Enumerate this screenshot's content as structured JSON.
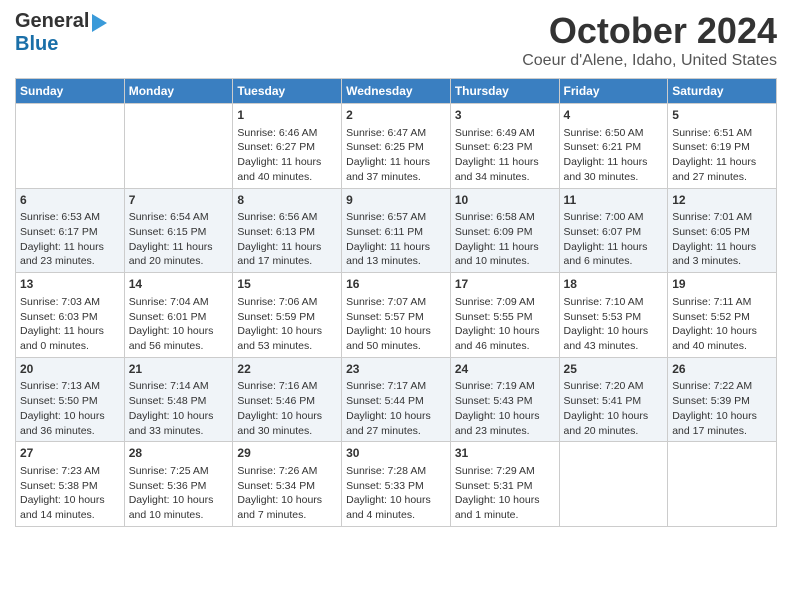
{
  "logo": {
    "line1": "General",
    "line2": "Blue"
  },
  "title": "October 2024",
  "subtitle": "Coeur d'Alene, Idaho, United States",
  "days_of_week": [
    "Sunday",
    "Monday",
    "Tuesday",
    "Wednesday",
    "Thursday",
    "Friday",
    "Saturday"
  ],
  "weeks": [
    [
      {
        "day": "",
        "content": ""
      },
      {
        "day": "",
        "content": ""
      },
      {
        "day": "1",
        "content": "Sunrise: 6:46 AM\nSunset: 6:27 PM\nDaylight: 11 hours\nand 40 minutes."
      },
      {
        "day": "2",
        "content": "Sunrise: 6:47 AM\nSunset: 6:25 PM\nDaylight: 11 hours\nand 37 minutes."
      },
      {
        "day": "3",
        "content": "Sunrise: 6:49 AM\nSunset: 6:23 PM\nDaylight: 11 hours\nand 34 minutes."
      },
      {
        "day": "4",
        "content": "Sunrise: 6:50 AM\nSunset: 6:21 PM\nDaylight: 11 hours\nand 30 minutes."
      },
      {
        "day": "5",
        "content": "Sunrise: 6:51 AM\nSunset: 6:19 PM\nDaylight: 11 hours\nand 27 minutes."
      }
    ],
    [
      {
        "day": "6",
        "content": "Sunrise: 6:53 AM\nSunset: 6:17 PM\nDaylight: 11 hours\nand 23 minutes."
      },
      {
        "day": "7",
        "content": "Sunrise: 6:54 AM\nSunset: 6:15 PM\nDaylight: 11 hours\nand 20 minutes."
      },
      {
        "day": "8",
        "content": "Sunrise: 6:56 AM\nSunset: 6:13 PM\nDaylight: 11 hours\nand 17 minutes."
      },
      {
        "day": "9",
        "content": "Sunrise: 6:57 AM\nSunset: 6:11 PM\nDaylight: 11 hours\nand 13 minutes."
      },
      {
        "day": "10",
        "content": "Sunrise: 6:58 AM\nSunset: 6:09 PM\nDaylight: 11 hours\nand 10 minutes."
      },
      {
        "day": "11",
        "content": "Sunrise: 7:00 AM\nSunset: 6:07 PM\nDaylight: 11 hours\nand 6 minutes."
      },
      {
        "day": "12",
        "content": "Sunrise: 7:01 AM\nSunset: 6:05 PM\nDaylight: 11 hours\nand 3 minutes."
      }
    ],
    [
      {
        "day": "13",
        "content": "Sunrise: 7:03 AM\nSunset: 6:03 PM\nDaylight: 11 hours\nand 0 minutes."
      },
      {
        "day": "14",
        "content": "Sunrise: 7:04 AM\nSunset: 6:01 PM\nDaylight: 10 hours\nand 56 minutes."
      },
      {
        "day": "15",
        "content": "Sunrise: 7:06 AM\nSunset: 5:59 PM\nDaylight: 10 hours\nand 53 minutes."
      },
      {
        "day": "16",
        "content": "Sunrise: 7:07 AM\nSunset: 5:57 PM\nDaylight: 10 hours\nand 50 minutes."
      },
      {
        "day": "17",
        "content": "Sunrise: 7:09 AM\nSunset: 5:55 PM\nDaylight: 10 hours\nand 46 minutes."
      },
      {
        "day": "18",
        "content": "Sunrise: 7:10 AM\nSunset: 5:53 PM\nDaylight: 10 hours\nand 43 minutes."
      },
      {
        "day": "19",
        "content": "Sunrise: 7:11 AM\nSunset: 5:52 PM\nDaylight: 10 hours\nand 40 minutes."
      }
    ],
    [
      {
        "day": "20",
        "content": "Sunrise: 7:13 AM\nSunset: 5:50 PM\nDaylight: 10 hours\nand 36 minutes."
      },
      {
        "day": "21",
        "content": "Sunrise: 7:14 AM\nSunset: 5:48 PM\nDaylight: 10 hours\nand 33 minutes."
      },
      {
        "day": "22",
        "content": "Sunrise: 7:16 AM\nSunset: 5:46 PM\nDaylight: 10 hours\nand 30 minutes."
      },
      {
        "day": "23",
        "content": "Sunrise: 7:17 AM\nSunset: 5:44 PM\nDaylight: 10 hours\nand 27 minutes."
      },
      {
        "day": "24",
        "content": "Sunrise: 7:19 AM\nSunset: 5:43 PM\nDaylight: 10 hours\nand 23 minutes."
      },
      {
        "day": "25",
        "content": "Sunrise: 7:20 AM\nSunset: 5:41 PM\nDaylight: 10 hours\nand 20 minutes."
      },
      {
        "day": "26",
        "content": "Sunrise: 7:22 AM\nSunset: 5:39 PM\nDaylight: 10 hours\nand 17 minutes."
      }
    ],
    [
      {
        "day": "27",
        "content": "Sunrise: 7:23 AM\nSunset: 5:38 PM\nDaylight: 10 hours\nand 14 minutes."
      },
      {
        "day": "28",
        "content": "Sunrise: 7:25 AM\nSunset: 5:36 PM\nDaylight: 10 hours\nand 10 minutes."
      },
      {
        "day": "29",
        "content": "Sunrise: 7:26 AM\nSunset: 5:34 PM\nDaylight: 10 hours\nand 7 minutes."
      },
      {
        "day": "30",
        "content": "Sunrise: 7:28 AM\nSunset: 5:33 PM\nDaylight: 10 hours\nand 4 minutes."
      },
      {
        "day": "31",
        "content": "Sunrise: 7:29 AM\nSunset: 5:31 PM\nDaylight: 10 hours\nand 1 minute."
      },
      {
        "day": "",
        "content": ""
      },
      {
        "day": "",
        "content": ""
      }
    ]
  ]
}
